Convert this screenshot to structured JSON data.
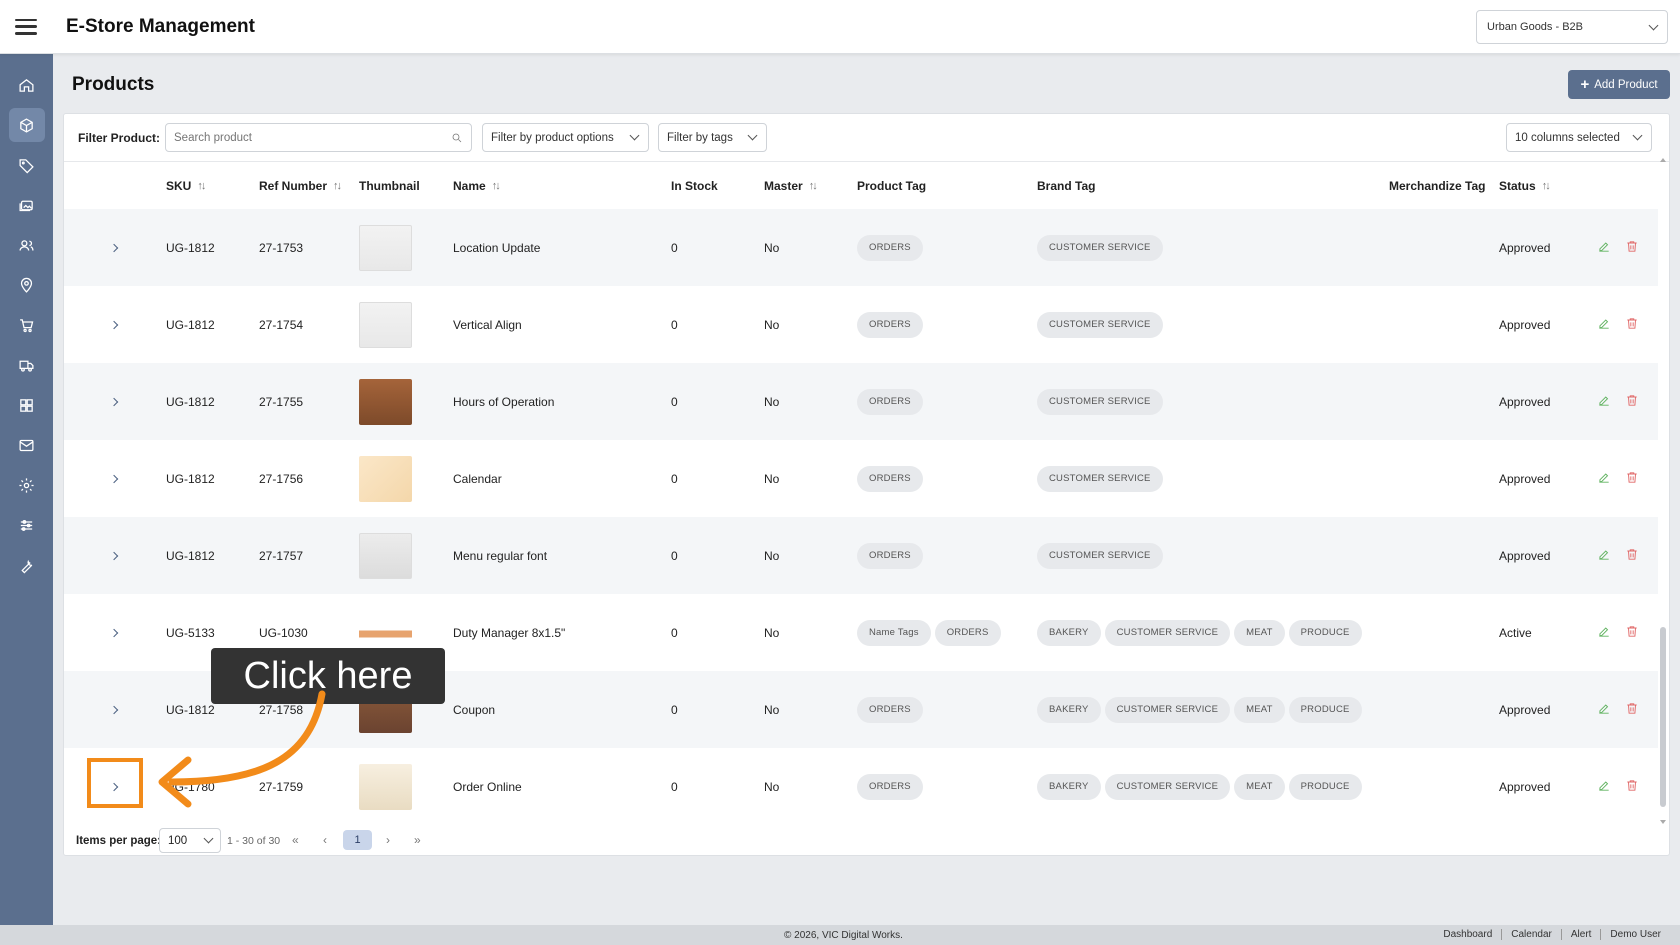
{
  "header": {
    "app_title": "E-Store Management",
    "store_selector": "Urban Goods - B2B"
  },
  "page": {
    "title": "Products",
    "add_button": "Add Product"
  },
  "filters": {
    "label": "Filter Product:",
    "search_placeholder": "Search product",
    "product_options": "Filter by product options",
    "tags": "Filter by tags",
    "columns": "10 columns selected"
  },
  "columns": {
    "sku": "SKU",
    "ref": "Ref Number",
    "thumbnail": "Thumbnail",
    "name": "Name",
    "stock": "In Stock",
    "master": "Master",
    "product_tag": "Product Tag",
    "brand_tag": "Brand Tag",
    "merch_tag": "Merchandize Tag",
    "status": "Status"
  },
  "rows": [
    {
      "sku": "UG-1812",
      "ref": "27-1753",
      "name": "Location Update",
      "stock": "0",
      "master": "No",
      "product_tags": [
        "ORDERS"
      ],
      "brand_tags": [
        "CUSTOMER SERVICE"
      ],
      "status": "Approved"
    },
    {
      "sku": "UG-1812",
      "ref": "27-1754",
      "name": "Vertical Align",
      "stock": "0",
      "master": "No",
      "product_tags": [
        "ORDERS"
      ],
      "brand_tags": [
        "CUSTOMER SERVICE"
      ],
      "status": "Approved"
    },
    {
      "sku": "UG-1812",
      "ref": "27-1755",
      "name": "Hours of Operation",
      "stock": "0",
      "master": "No",
      "product_tags": [
        "ORDERS"
      ],
      "brand_tags": [
        "CUSTOMER SERVICE"
      ],
      "status": "Approved"
    },
    {
      "sku": "UG-1812",
      "ref": "27-1756",
      "name": "Calendar",
      "stock": "0",
      "master": "No",
      "product_tags": [
        "ORDERS"
      ],
      "brand_tags": [
        "CUSTOMER SERVICE"
      ],
      "status": "Approved"
    },
    {
      "sku": "UG-1812",
      "ref": "27-1757",
      "name": "Menu regular font",
      "stock": "0",
      "master": "No",
      "product_tags": [
        "ORDERS"
      ],
      "brand_tags": [
        "CUSTOMER SERVICE"
      ],
      "status": "Approved"
    },
    {
      "sku": "UG-5133",
      "ref": "UG-1030",
      "name": "Duty Manager 8x1.5\"",
      "stock": "0",
      "master": "No",
      "product_tags": [
        "Name Tags",
        "ORDERS"
      ],
      "brand_tags": [
        "BAKERY",
        "CUSTOMER SERVICE",
        "MEAT",
        "PRODUCE"
      ],
      "status": "Active"
    },
    {
      "sku": "UG-1812",
      "ref": "27-1758",
      "name": "Coupon",
      "stock": "0",
      "master": "No",
      "product_tags": [
        "ORDERS"
      ],
      "brand_tags": [
        "BAKERY",
        "CUSTOMER SERVICE",
        "MEAT",
        "PRODUCE"
      ],
      "status": "Approved"
    },
    {
      "sku": "UG-1780",
      "ref": "27-1759",
      "name": "Order Online",
      "stock": "0",
      "master": "No",
      "product_tags": [
        "ORDERS"
      ],
      "brand_tags": [
        "BAKERY",
        "CUSTOMER SERVICE",
        "MEAT",
        "PRODUCE"
      ],
      "status": "Approved"
    }
  ],
  "pagination": {
    "label": "Items per page:",
    "per_page": "100",
    "range": "1 - 30 of 30",
    "current_page": "1"
  },
  "footer": {
    "copyright": "© 2026, VIC Digital Works.",
    "links": [
      "Dashboard",
      "Calendar",
      "Alert",
      "Demo User"
    ]
  },
  "callout": {
    "text": "Click here"
  },
  "colors": {
    "sidebar": "#5b6f8e",
    "accent": "#5b6f8e",
    "highlight": "#f28b1a",
    "edit": "#5fb25f",
    "delete": "#e06666"
  }
}
